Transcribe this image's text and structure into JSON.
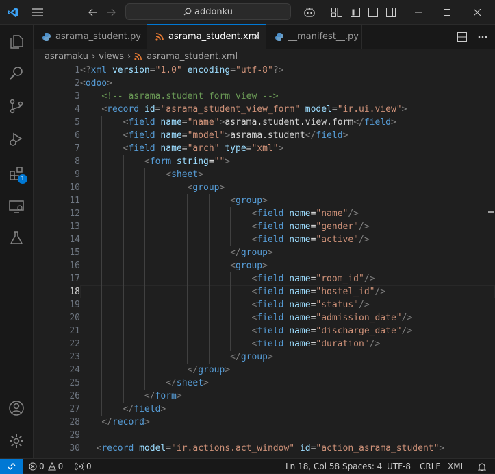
{
  "titlebar": {
    "search_text": "addonku"
  },
  "activity_bar": {
    "extensions_badge": "1"
  },
  "tabs": [
    {
      "label": "asrama_student.py",
      "icon": "python-file-icon",
      "active": false
    },
    {
      "label": "asrama_student.xml",
      "icon": "rss-xml-file-icon",
      "active": true
    },
    {
      "label": "__manifest__.py",
      "icon": "python-file-icon",
      "active": false
    }
  ],
  "breadcrumb": [
    "asramaku",
    "views",
    "asrama_student.xml"
  ],
  "editor": {
    "current_line": 18,
    "lines": [
      {
        "n": "1",
        "tokens": [
          [
            "b",
            "<?"
          ],
          [
            "tag",
            "xml"
          ],
          [
            "t",
            " "
          ],
          [
            "attr",
            "version"
          ],
          [
            "eq",
            "="
          ],
          [
            "str",
            "\"1.0\""
          ],
          [
            "t",
            " "
          ],
          [
            "attr",
            "encoding"
          ],
          [
            "eq",
            "="
          ],
          [
            "str",
            "\"utf-8\""
          ],
          [
            "b",
            "?>"
          ]
        ]
      },
      {
        "n": "2",
        "tokens": [
          [
            "b",
            "<"
          ],
          [
            "tag",
            "odoo"
          ],
          [
            "b",
            ">"
          ]
        ]
      },
      {
        "n": "3",
        "tokens": [
          [
            "t",
            "    "
          ],
          [
            "cm",
            "<!-- asrama.student form view -->"
          ]
        ]
      },
      {
        "n": "4",
        "tokens": [
          [
            "t",
            "    "
          ],
          [
            "b",
            "<"
          ],
          [
            "tag",
            "record"
          ],
          [
            "t",
            " "
          ],
          [
            "attr",
            "id"
          ],
          [
            "eq",
            "="
          ],
          [
            "str",
            "\"asrama_student_view_form\""
          ],
          [
            "t",
            " "
          ],
          [
            "attr",
            "model"
          ],
          [
            "eq",
            "="
          ],
          [
            "str",
            "\"ir.ui.view\""
          ],
          [
            "b",
            ">"
          ]
        ]
      },
      {
        "n": "5",
        "tokens": [
          [
            "t",
            "        "
          ],
          [
            "b",
            "<"
          ],
          [
            "tag",
            "field"
          ],
          [
            "t",
            " "
          ],
          [
            "attr",
            "name"
          ],
          [
            "eq",
            "="
          ],
          [
            "str",
            "\"name\""
          ],
          [
            "b",
            ">"
          ],
          [
            "t",
            "asrama.student.view.form"
          ],
          [
            "b",
            "</"
          ],
          [
            "tag",
            "field"
          ],
          [
            "b",
            ">"
          ]
        ]
      },
      {
        "n": "6",
        "tokens": [
          [
            "t",
            "        "
          ],
          [
            "b",
            "<"
          ],
          [
            "tag",
            "field"
          ],
          [
            "t",
            " "
          ],
          [
            "attr",
            "name"
          ],
          [
            "eq",
            "="
          ],
          [
            "str",
            "\"model\""
          ],
          [
            "b",
            ">"
          ],
          [
            "t",
            "asrama.student"
          ],
          [
            "b",
            "</"
          ],
          [
            "tag",
            "field"
          ],
          [
            "b",
            ">"
          ]
        ]
      },
      {
        "n": "7",
        "tokens": [
          [
            "t",
            "        "
          ],
          [
            "b",
            "<"
          ],
          [
            "tag",
            "field"
          ],
          [
            "t",
            " "
          ],
          [
            "attr",
            "name"
          ],
          [
            "eq",
            "="
          ],
          [
            "str",
            "\"arch\""
          ],
          [
            "t",
            " "
          ],
          [
            "attr",
            "type"
          ],
          [
            "eq",
            "="
          ],
          [
            "str",
            "\"xml\""
          ],
          [
            "b",
            ">"
          ]
        ]
      },
      {
        "n": "8",
        "tokens": [
          [
            "t",
            "            "
          ],
          [
            "b",
            "<"
          ],
          [
            "tag",
            "form"
          ],
          [
            "t",
            " "
          ],
          [
            "attr",
            "string"
          ],
          [
            "eq",
            "="
          ],
          [
            "str",
            "\"\""
          ],
          [
            "b",
            ">"
          ]
        ]
      },
      {
        "n": "9",
        "tokens": [
          [
            "t",
            "                "
          ],
          [
            "b",
            "<"
          ],
          [
            "tag",
            "sheet"
          ],
          [
            "b",
            ">"
          ]
        ]
      },
      {
        "n": "10",
        "tokens": [
          [
            "t",
            "                    "
          ],
          [
            "b",
            "<"
          ],
          [
            "tag",
            "group"
          ],
          [
            "b",
            ">"
          ]
        ]
      },
      {
        "n": "11",
        "tokens": [
          [
            "t",
            "                            "
          ],
          [
            "b",
            "<"
          ],
          [
            "tag",
            "group"
          ],
          [
            "b",
            ">"
          ]
        ]
      },
      {
        "n": "12",
        "tokens": [
          [
            "t",
            "                                "
          ],
          [
            "b",
            "<"
          ],
          [
            "tag",
            "field"
          ],
          [
            "t",
            " "
          ],
          [
            "attr",
            "name"
          ],
          [
            "eq",
            "="
          ],
          [
            "str",
            "\"name\""
          ],
          [
            "b",
            "/>"
          ]
        ]
      },
      {
        "n": "13",
        "tokens": [
          [
            "t",
            "                                "
          ],
          [
            "b",
            "<"
          ],
          [
            "tag",
            "field"
          ],
          [
            "t",
            " "
          ],
          [
            "attr",
            "name"
          ],
          [
            "eq",
            "="
          ],
          [
            "str",
            "\"gender\""
          ],
          [
            "b",
            "/>"
          ]
        ]
      },
      {
        "n": "14",
        "tokens": [
          [
            "t",
            "                                "
          ],
          [
            "b",
            "<"
          ],
          [
            "tag",
            "field"
          ],
          [
            "t",
            " "
          ],
          [
            "attr",
            "name"
          ],
          [
            "eq",
            "="
          ],
          [
            "str",
            "\"active\""
          ],
          [
            "b",
            "/>"
          ]
        ]
      },
      {
        "n": "15",
        "tokens": [
          [
            "t",
            "                            "
          ],
          [
            "b",
            "</"
          ],
          [
            "tag",
            "group"
          ],
          [
            "b",
            ">"
          ]
        ]
      },
      {
        "n": "16",
        "tokens": [
          [
            "t",
            "                            "
          ],
          [
            "b",
            "<"
          ],
          [
            "tag",
            "group"
          ],
          [
            "b",
            ">"
          ]
        ]
      },
      {
        "n": "17",
        "tokens": [
          [
            "t",
            "                                "
          ],
          [
            "b",
            "<"
          ],
          [
            "tag",
            "field"
          ],
          [
            "t",
            " "
          ],
          [
            "attr",
            "name"
          ],
          [
            "eq",
            "="
          ],
          [
            "str",
            "\"room_id\""
          ],
          [
            "b",
            "/>"
          ]
        ]
      },
      {
        "n": "18",
        "tokens": [
          [
            "t",
            "                                "
          ],
          [
            "b",
            "<"
          ],
          [
            "tag",
            "field"
          ],
          [
            "t",
            " "
          ],
          [
            "attr",
            "name"
          ],
          [
            "eq",
            "="
          ],
          [
            "str",
            "\"hostel_id\""
          ],
          [
            "b",
            "/>"
          ]
        ]
      },
      {
        "n": "19",
        "tokens": [
          [
            "t",
            "                                "
          ],
          [
            "b",
            "<"
          ],
          [
            "tag",
            "field"
          ],
          [
            "t",
            " "
          ],
          [
            "attr",
            "name"
          ],
          [
            "eq",
            "="
          ],
          [
            "str",
            "\"status\""
          ],
          [
            "b",
            "/>"
          ]
        ]
      },
      {
        "n": "20",
        "tokens": [
          [
            "t",
            "                                "
          ],
          [
            "b",
            "<"
          ],
          [
            "tag",
            "field"
          ],
          [
            "t",
            " "
          ],
          [
            "attr",
            "name"
          ],
          [
            "eq",
            "="
          ],
          [
            "str",
            "\"admission_date\""
          ],
          [
            "b",
            "/>"
          ]
        ]
      },
      {
        "n": "21",
        "tokens": [
          [
            "t",
            "                                "
          ],
          [
            "b",
            "<"
          ],
          [
            "tag",
            "field"
          ],
          [
            "t",
            " "
          ],
          [
            "attr",
            "name"
          ],
          [
            "eq",
            "="
          ],
          [
            "str",
            "\"discharge_date\""
          ],
          [
            "b",
            "/>"
          ]
        ]
      },
      {
        "n": "22",
        "tokens": [
          [
            "t",
            "                                "
          ],
          [
            "b",
            "<"
          ],
          [
            "tag",
            "field"
          ],
          [
            "t",
            " "
          ],
          [
            "attr",
            "name"
          ],
          [
            "eq",
            "="
          ],
          [
            "str",
            "\"duration\""
          ],
          [
            "b",
            "/>"
          ]
        ]
      },
      {
        "n": "23",
        "tokens": [
          [
            "t",
            "                            "
          ],
          [
            "b",
            "</"
          ],
          [
            "tag",
            "group"
          ],
          [
            "b",
            ">"
          ]
        ]
      },
      {
        "n": "24",
        "tokens": [
          [
            "t",
            "                    "
          ],
          [
            "b",
            "</"
          ],
          [
            "tag",
            "group"
          ],
          [
            "b",
            ">"
          ]
        ]
      },
      {
        "n": "25",
        "tokens": [
          [
            "t",
            "                "
          ],
          [
            "b",
            "</"
          ],
          [
            "tag",
            "sheet"
          ],
          [
            "b",
            ">"
          ]
        ]
      },
      {
        "n": "26",
        "tokens": [
          [
            "t",
            "            "
          ],
          [
            "b",
            "</"
          ],
          [
            "tag",
            "form"
          ],
          [
            "b",
            ">"
          ]
        ]
      },
      {
        "n": "27",
        "tokens": [
          [
            "t",
            "        "
          ],
          [
            "b",
            "</"
          ],
          [
            "tag",
            "field"
          ],
          [
            "b",
            ">"
          ]
        ]
      },
      {
        "n": "28",
        "tokens": [
          [
            "t",
            "    "
          ],
          [
            "b",
            "</"
          ],
          [
            "tag",
            "record"
          ],
          [
            "b",
            ">"
          ]
        ]
      },
      {
        "n": "29",
        "tokens": []
      },
      {
        "n": "30",
        "tokens": [
          [
            "t",
            "   "
          ],
          [
            "b",
            "<"
          ],
          [
            "tag",
            "record"
          ],
          [
            "t",
            " "
          ],
          [
            "attr",
            "model"
          ],
          [
            "eq",
            "="
          ],
          [
            "str",
            "\"ir.actions.act_window\""
          ],
          [
            "t",
            " "
          ],
          [
            "attr",
            "id"
          ],
          [
            "eq",
            "="
          ],
          [
            "str",
            "\"action_asrama_student\""
          ],
          [
            "b",
            ">"
          ]
        ]
      }
    ]
  },
  "statusbar": {
    "errors": "0",
    "warnings": "0",
    "ports": "0",
    "position": "Ln 18, Col 58",
    "spaces": "Spaces: 4",
    "encoding": "UTF-8",
    "eol": "CRLF",
    "language": "XML"
  },
  "colors": {
    "accent": "#0078d4",
    "tag": "#569cd6",
    "attr": "#9cdcfe",
    "string": "#ce9178",
    "comment": "#6a9955"
  }
}
